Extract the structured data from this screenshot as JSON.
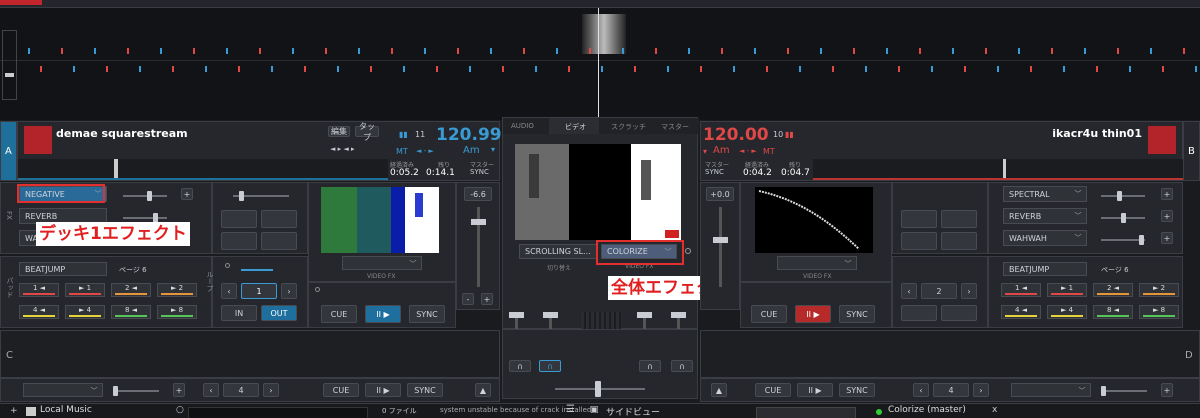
{
  "colors": {
    "accent_blue": "#3a9bd4",
    "deck_b_red": "#e04848",
    "annotation_red": "#e02020"
  },
  "deck_a": {
    "letter": "A",
    "title": "demae squarestream",
    "edit_label": "編集",
    "tap_label": "タップ",
    "bpm": "120.99",
    "bars": "11",
    "key_mt": "MT",
    "key": "Am",
    "elapsed_label": "経過済み",
    "elapsed": "0:05.2",
    "remain_label": "残り",
    "remain": "0:14.1",
    "master_label": "マスター",
    "master_value": "SYNC",
    "fx1": "NEGATIVE",
    "fx2": "REVERB",
    "fx3": "WA",
    "fx_side": "FX",
    "pad_mode": "BEATJUMP",
    "page_label": "ページ 6",
    "hotcues": [
      [
        "1",
        "◄",
        "red"
      ],
      [
        "► 1",
        "",
        "red"
      ],
      [
        "2",
        "◄",
        "orange"
      ],
      [
        "► 2",
        "",
        "orange"
      ],
      [
        "4",
        "◄",
        "yellow"
      ],
      [
        "► 4",
        "",
        "yellow"
      ],
      [
        "8",
        "◄",
        "green"
      ],
      [
        "► 8",
        "",
        "green"
      ]
    ],
    "pad_side": "パッド",
    "loop_side": "ループ",
    "loop_value": "1",
    "loop_in": "IN",
    "loop_out": "OUT",
    "video_fx_label": "VIDEO FX",
    "gain": "-6.6",
    "cue": "CUE",
    "play": "II ▶",
    "sync": "SYNC",
    "minus": "-",
    "plus": "+"
  },
  "deck_b": {
    "letter": "B",
    "title": "ikacr4u thin01",
    "bpm": "120.00",
    "bars": "10",
    "key_mt": "MT",
    "key": "Am",
    "elapsed_label": "経過済み",
    "elapsed": "0:04.2",
    "remain_label": "残り",
    "remain": "0:04.7",
    "master_label": "マスター",
    "master_value": "SYNC",
    "fx1": "SPECTRAL",
    "fx2": "REVERB",
    "fx3": "WAHWAH",
    "pad_mode": "BEATJUMP",
    "page_label": "ページ 6",
    "loop_value": "2",
    "video_fx_label": "VIDEO FX",
    "gain": "+0.0",
    "cue": "CUE",
    "play": "II ▶",
    "sync": "SYNC"
  },
  "center": {
    "tabs": [
      "AUDIO",
      "ビデオ",
      "スクラッチ",
      "マスター"
    ],
    "transition": "SCROLLING SL...",
    "transition_caption": "切り替え",
    "master_fx": "COLORIZE",
    "master_fx_caption": "VIDEO FX"
  },
  "deck_c": {
    "letter": "C",
    "loop_value": "4",
    "cue": "CUE",
    "play": "II ▶",
    "sync": "SYNC"
  },
  "deck_d": {
    "letter": "D",
    "loop_value": "4",
    "cue": "CUE",
    "play": "II ▶",
    "sync": "SYNC"
  },
  "annotations": {
    "deck_fx": "デッキ1エフェクト",
    "master_fx": "全体エフェクト"
  },
  "browser": {
    "local_music": "Local Music",
    "files": "0 ファイル",
    "status": "system unstable because of crack installed",
    "sideview": "サイドビュー",
    "colorize_master": "Colorize (master)",
    "close": "x"
  },
  "icons": [
    "play-icon",
    "prev-icon",
    "next-icon",
    "headphone-icon",
    "chevron-down-icon",
    "plus-icon",
    "menu-icon"
  ]
}
